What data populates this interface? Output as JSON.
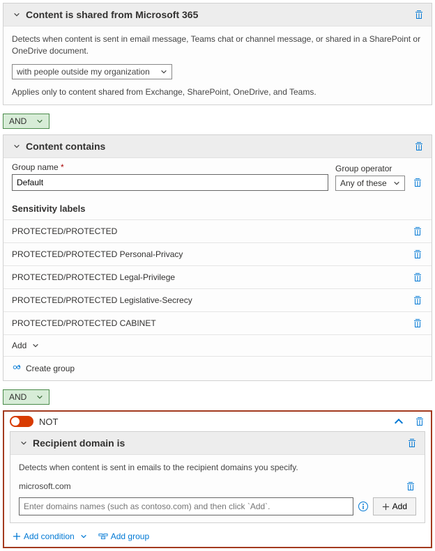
{
  "section1": {
    "title": "Content is shared from Microsoft 365",
    "desc": "Detects when content is sent in email message, Teams chat or channel message, or shared in a SharePoint or OneDrive document.",
    "dropdown": "with people outside my organization",
    "note": "Applies only to content shared from Exchange, SharePoint, OneDrive, and Teams."
  },
  "and_label": "AND",
  "section2": {
    "title": "Content contains",
    "group_name_label": "Group name",
    "group_name_value": "Default",
    "group_operator_label": "Group operator",
    "group_operator_value": "Any of these",
    "list_header": "Sensitivity labels",
    "items": [
      "PROTECTED/PROTECTED",
      "PROTECTED/PROTECTED Personal-Privacy",
      "PROTECTED/PROTECTED Legal-Privilege",
      "PROTECTED/PROTECTED Legislative-Secrecy",
      "PROTECTED/PROTECTED CABINET"
    ],
    "add_label": "Add",
    "create_group_label": "Create group"
  },
  "not_label": "NOT",
  "section3": {
    "title": "Recipient domain is",
    "desc": "Detects when content is sent in emails to the recipient domains you specify.",
    "domain_value": "microsoft.com",
    "input_placeholder": "Enter domains names (such as contoso.com) and then click `Add`.",
    "add_btn": "Add"
  },
  "footer": {
    "add_condition": "Add condition",
    "add_group": "Add group"
  }
}
